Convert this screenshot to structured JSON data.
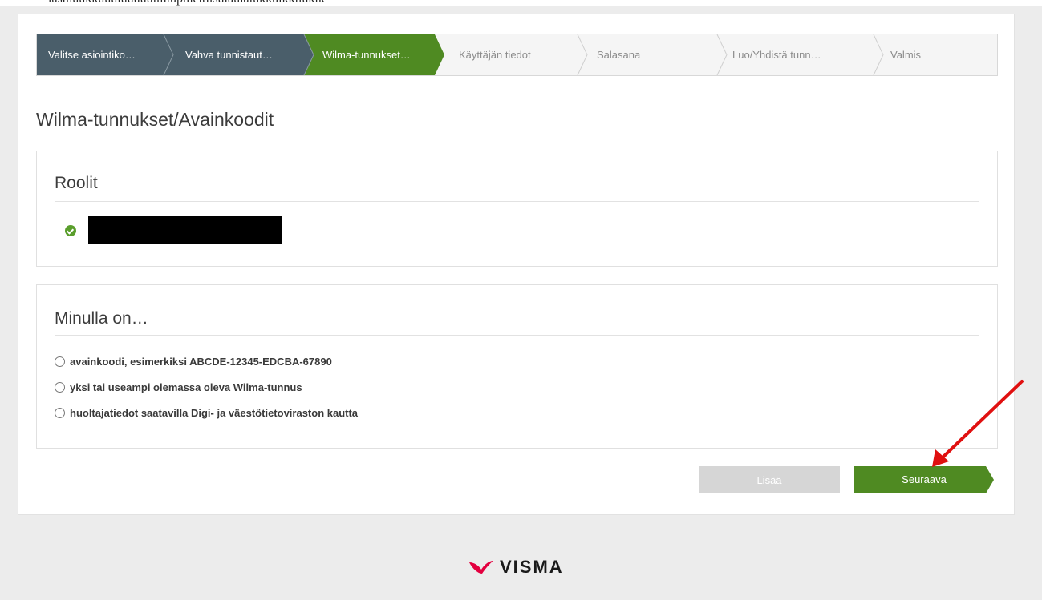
{
  "top_cut_text": "lasmuukkuuuluuuuulmlupmeltilsulaulalukkulkkiluklk",
  "wizard": {
    "steps": [
      {
        "label": "Valitse asiointiko…",
        "state": "done"
      },
      {
        "label": "Vahva tunnistaut…",
        "state": "done"
      },
      {
        "label": "Wilma-tunnukset…",
        "state": "active"
      },
      {
        "label": "Käyttäjän tiedot",
        "state": "todo"
      },
      {
        "label": "Salasana",
        "state": "todo"
      },
      {
        "label": "Luo/Yhdistä tunn…",
        "state": "todo"
      },
      {
        "label": "Valmis",
        "state": "todo"
      }
    ],
    "colors": {
      "done": "#4a5e6a",
      "active": "#4f8a22",
      "todo": "#f5f5f5"
    }
  },
  "page_title": "Wilma-tunnukset/Avainkoodit",
  "roles": {
    "title": "Roolit",
    "check_icon": "check-circle-icon"
  },
  "options": {
    "title": "Minulla on…",
    "items": [
      {
        "label": "avainkoodi, esimerkiksi ABCDE-12345-EDCBA-67890"
      },
      {
        "label": "yksi tai useampi olemassa oleva Wilma-tunnus"
      },
      {
        "label": "huoltajatiedot saatavilla Digi- ja väestötietoviraston kautta"
      }
    ]
  },
  "buttons": {
    "add_label": "Lisää",
    "next_label": "Seuraava",
    "next_color": "#4f8a22"
  },
  "annotation_color": "#e01010",
  "logo": {
    "text": "VISMA",
    "color": "#e3003f"
  }
}
